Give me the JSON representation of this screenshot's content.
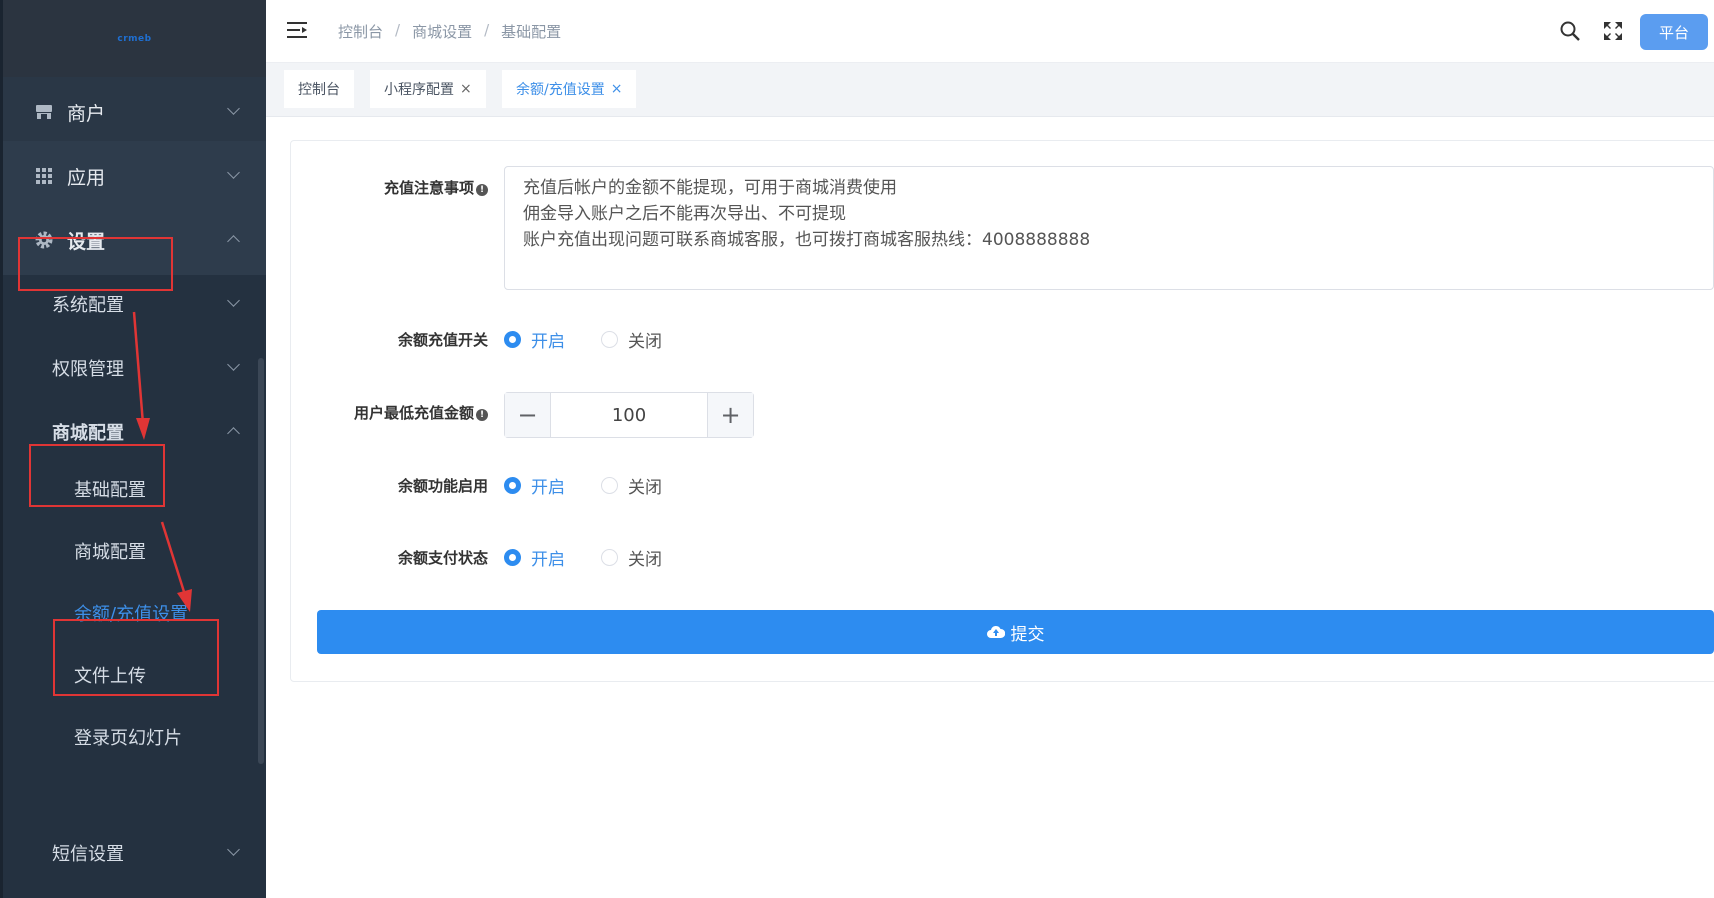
{
  "app": {
    "logo_text": "crmeb"
  },
  "sidebar": {
    "items": [
      {
        "label": "商户",
        "icon": "shop-icon"
      },
      {
        "label": "应用",
        "icon": "apps-grid-icon"
      },
      {
        "label": "设置",
        "icon": "gear-icon"
      }
    ],
    "settings_children": [
      {
        "label": "系统配置"
      },
      {
        "label": "权限管理"
      },
      {
        "label": "商城配置"
      }
    ],
    "mall_children": [
      {
        "label": "基础配置"
      },
      {
        "label": "商城配置"
      },
      {
        "label": "余额/充值设置"
      },
      {
        "label": "文件上传"
      },
      {
        "label": "登录页幻灯片"
      }
    ],
    "sms": {
      "label": "短信设置"
    }
  },
  "header": {
    "breadcrumb": [
      "控制台",
      "商城设置",
      "基础配置"
    ],
    "breadcrumb_sep": "/",
    "platform_label": "平台"
  },
  "tabs": [
    {
      "label": "控制台",
      "closable": false
    },
    {
      "label": "小程序配置",
      "closable": true
    },
    {
      "label": "余额/充值设置",
      "closable": true,
      "active": true
    }
  ],
  "tab_close_glyph": "×",
  "form": {
    "notice_label": "充值注意事项",
    "notice_lines": [
      "充值后帐户的金额不能提现，可用于商城消费使用",
      "佣金导入账户之后不能再次导出、不可提现",
      "账户充值出现问题可联系商城客服，也可拨打商城客服热线：4008888888"
    ],
    "recharge_switch_label": "余额充值开关",
    "min_recharge_label": "用户最低充值金额",
    "min_recharge_value": "100",
    "balance_enable_label": "余额功能启用",
    "balance_pay_label": "余额支付状态",
    "on_label": "开启",
    "off_label": "关闭",
    "minus": "−",
    "plus": "+",
    "tip_glyph": "!",
    "submit_label": "提交"
  },
  "colors": {
    "primary": "#2d8cf0",
    "sidebar_bg": "#243140",
    "highlight": "#e03535"
  }
}
